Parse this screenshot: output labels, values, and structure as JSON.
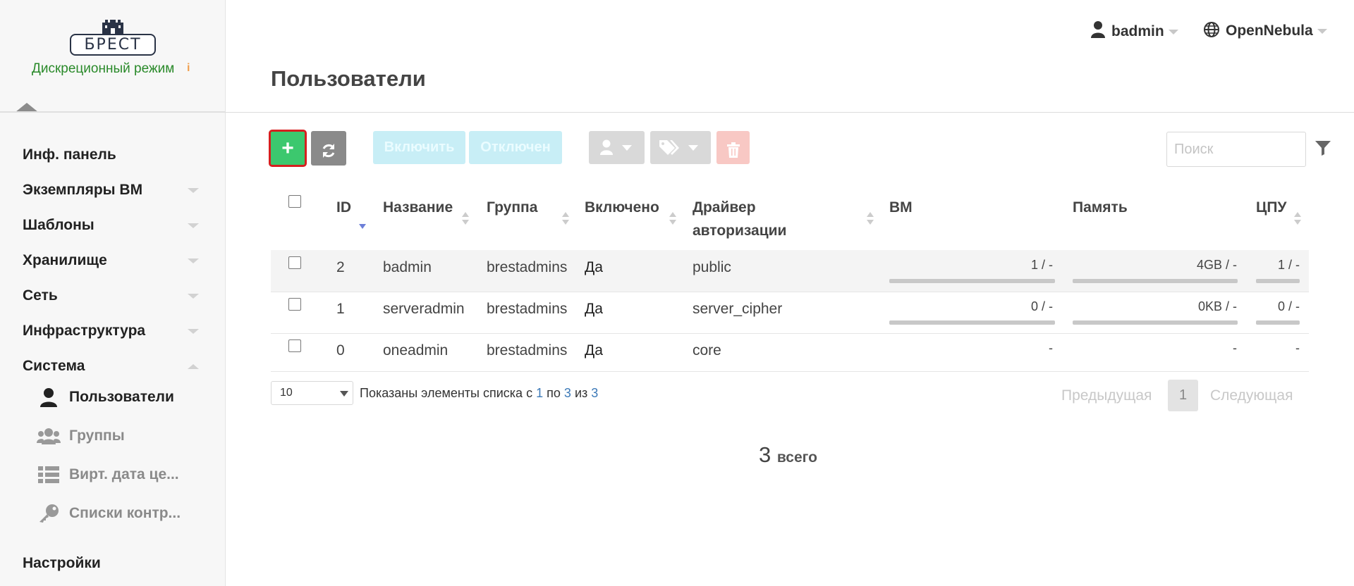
{
  "sidebar": {
    "logo_text": "БРЕСТ",
    "mode_label": "Дискреционный режим",
    "mode_info_icon": "i",
    "items": [
      {
        "label": "Инф. панель",
        "icon": "none",
        "expandable": false
      },
      {
        "label": "Экземпляры ВМ",
        "icon": "chevron-down-icon",
        "expandable": true
      },
      {
        "label": "Шаблоны",
        "icon": "chevron-down-icon",
        "expandable": true
      },
      {
        "label": "Хранилище",
        "icon": "chevron-down-icon",
        "expandable": true
      },
      {
        "label": "Сеть",
        "icon": "chevron-down-icon",
        "expandable": true
      },
      {
        "label": "Инфраструктура",
        "icon": "chevron-down-icon",
        "expandable": true
      },
      {
        "label": "Система",
        "icon": "chevron-up-icon",
        "expandable": true
      },
      {
        "label": "Настройки",
        "icon": "none",
        "expandable": false
      }
    ],
    "system_subitems": [
      {
        "label": "Пользователи",
        "icon": "user-icon",
        "active": true
      },
      {
        "label": "Группы",
        "icon": "users-icon",
        "active": false
      },
      {
        "label": "Вирт. дата це...",
        "icon": "table-list-icon",
        "active": false
      },
      {
        "label": "Списки контр...",
        "icon": "key-icon",
        "active": false
      }
    ]
  },
  "header": {
    "user": "badmin",
    "zone": "OpenNebula",
    "page_title": "Пользователи"
  },
  "toolbar": {
    "add_label": "+",
    "enable_label": "Включить",
    "disable_label": "Отключен",
    "search_placeholder": "Поиск"
  },
  "table": {
    "columns": [
      "ID",
      "Название",
      "Группа",
      "Включено",
      "Драйвер авторизации",
      "ВМ",
      "Память",
      "ЦПУ"
    ],
    "rows": [
      {
        "id": "2",
        "name": "badmin",
        "group": "brestadmins",
        "enabled": "Да",
        "auth": "public",
        "vm": "1 / -",
        "memory": "4GB / -",
        "cpu": "1 / -"
      },
      {
        "id": "1",
        "name": "serveradmin",
        "group": "brestadmins",
        "enabled": "Да",
        "auth": "server_cipher",
        "vm": "0 / -",
        "memory": "0KB / -",
        "cpu": "0 / -"
      },
      {
        "id": "0",
        "name": "oneadmin",
        "group": "brestadmins",
        "enabled": "Да",
        "auth": "core",
        "vm": "-",
        "memory": "-",
        "cpu": "-"
      }
    ]
  },
  "footer": {
    "page_size": "10",
    "info_prefix": "Показаны элементы списка с",
    "info_from": "1",
    "info_mid1": "по",
    "info_to": "3",
    "info_mid2": "из",
    "info_total": "3",
    "prev_label": "Предыдущая",
    "page": "1",
    "next_label": "Следующая",
    "total_count": "3",
    "total_label": "всего"
  },
  "colors": {
    "add_button": "#3cc86e",
    "refresh_button": "#8a8a8a",
    "enable_buttons": "#c8eef6",
    "delete_button": "#f8c8c4",
    "mode_text": "#2a8a2a"
  }
}
